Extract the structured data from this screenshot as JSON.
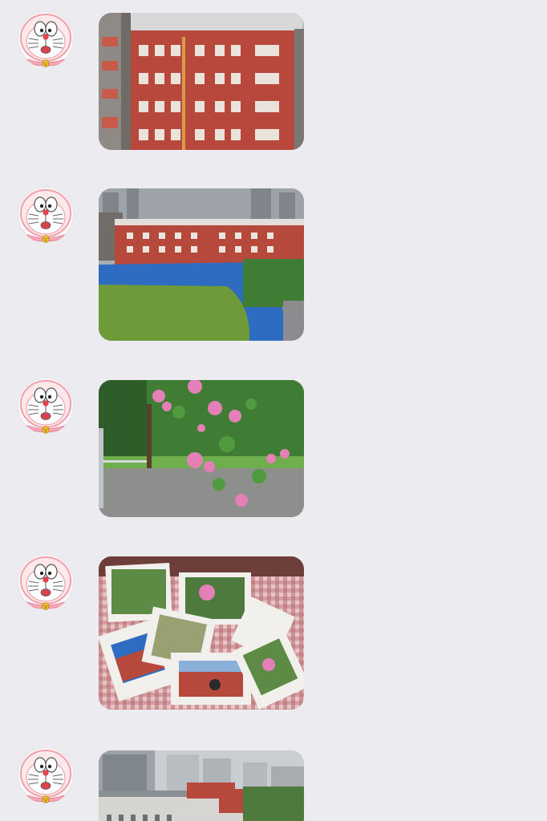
{
  "chat": {
    "background": "#ececf0",
    "messages": [
      {
        "sender_avatar": "doraemon-pink-avatar",
        "type": "image",
        "subject": "red-brick-school-building"
      },
      {
        "sender_avatar": "doraemon-pink-avatar",
        "type": "image",
        "subject": "school-sports-field-aerial"
      },
      {
        "sender_avatar": "doraemon-pink-avatar",
        "type": "image",
        "subject": "pink-roses-over-stairway"
      },
      {
        "sender_avatar": "doraemon-pink-avatar",
        "type": "image",
        "subject": "printed-photos-on-tablecloth"
      },
      {
        "sender_avatar": "doraemon-pink-avatar",
        "type": "image",
        "subject": "city-skyline-rooftops"
      }
    ]
  },
  "colors": {
    "avatar_face": "#ffffff",
    "avatar_outline": "#f2a0a8",
    "avatar_nose": "#e8434b",
    "avatar_bell": "#f2c230",
    "brick": "#b8483b",
    "track": "#2d6cc0",
    "grass": "#6e9a3a",
    "rose": "#e57fb8",
    "foliage": "#3f7d35"
  }
}
